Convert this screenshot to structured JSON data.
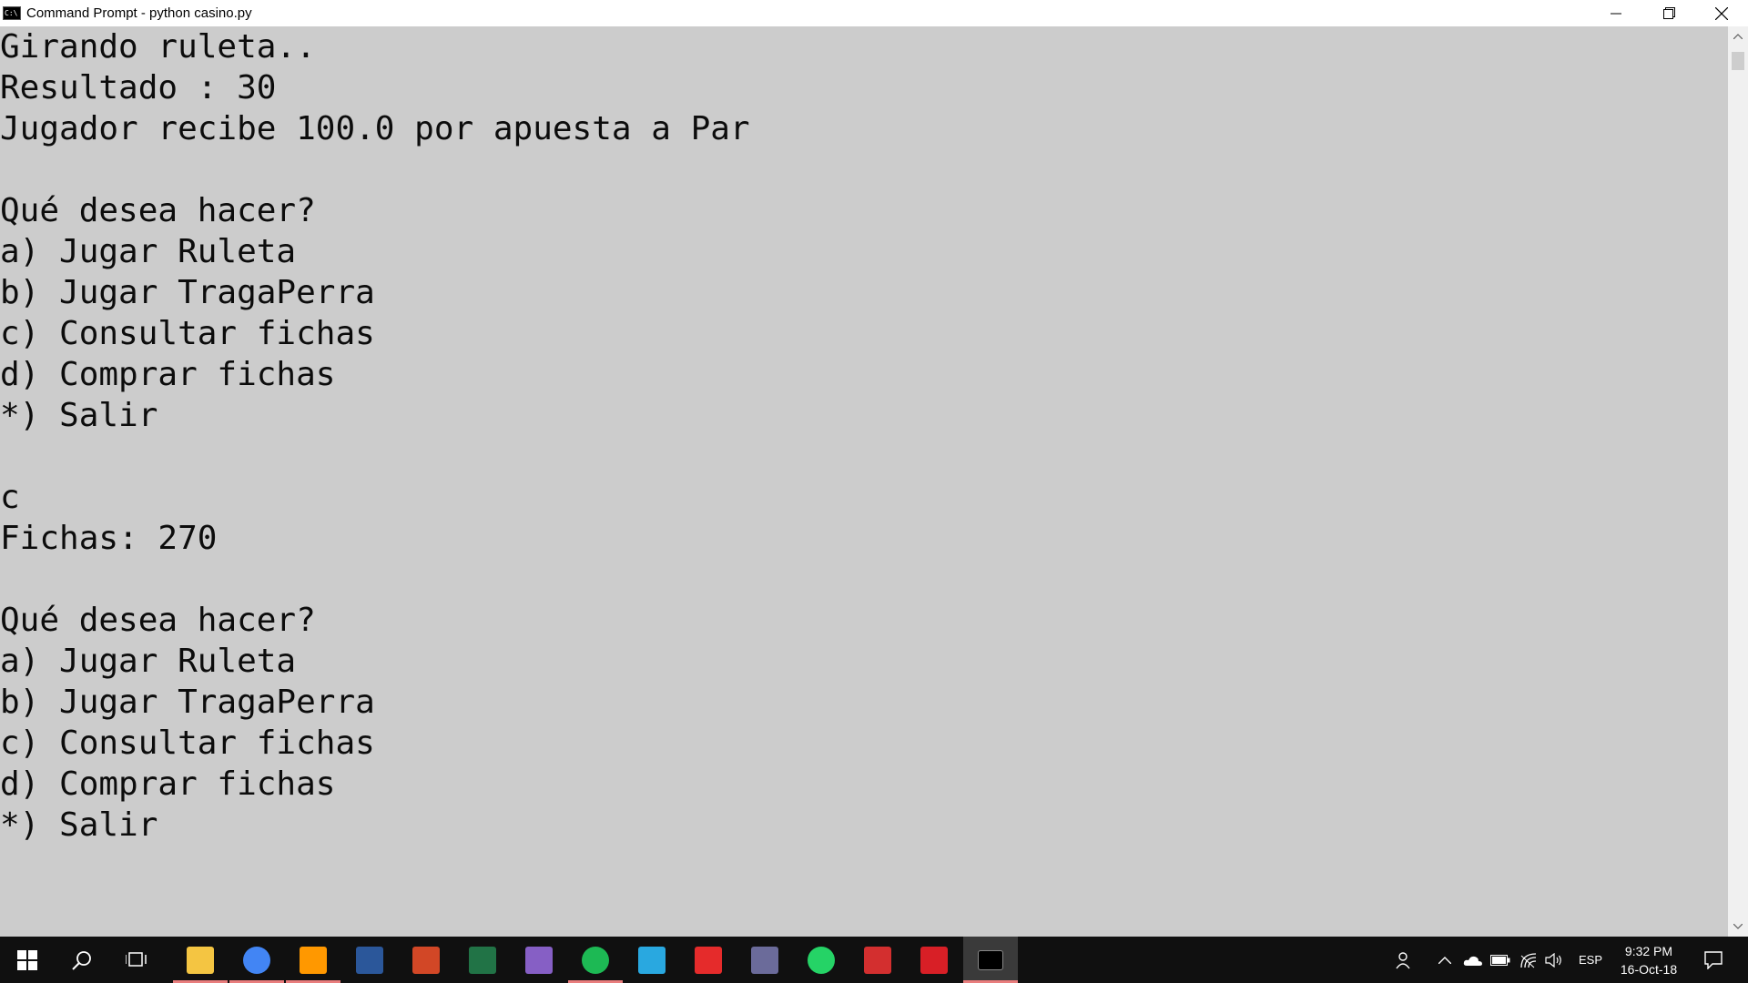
{
  "window": {
    "title": "Command Prompt - python  casino.py"
  },
  "console": {
    "lines": [
      "Girando ruleta..",
      "Resultado : 30",
      "Jugador recibe 100.0 por apuesta a Par",
      "",
      "Qué desea hacer?",
      "a) Jugar Ruleta",
      "b) Jugar TragaPerra",
      "c) Consultar fichas",
      "d) Comprar fichas",
      "*) Salir",
      "",
      "c",
      "Fichas: 270",
      "",
      "Qué desea hacer?",
      "a) Jugar Ruleta",
      "b) Jugar TragaPerra",
      "c) Consultar fichas",
      "d) Comprar fichas",
      "*) Salir",
      ""
    ]
  },
  "taskbar": {
    "apps": [
      {
        "name": "file-explorer",
        "color": "#f4c542"
      },
      {
        "name": "chrome",
        "color": "#4285f4"
      },
      {
        "name": "sublime-text",
        "color": "#ff9800"
      },
      {
        "name": "word",
        "color": "#2b579a"
      },
      {
        "name": "powerpoint",
        "color": "#d24726"
      },
      {
        "name": "excel",
        "color": "#217346"
      },
      {
        "name": "visual-studio",
        "color": "#865fc5"
      },
      {
        "name": "spotify",
        "color": "#1db954"
      },
      {
        "name": "store",
        "color": "#29a8e0"
      },
      {
        "name": "app-red-gear",
        "color": "#e52b2b"
      },
      {
        "name": "app-chart",
        "color": "#6b6b9a"
      },
      {
        "name": "whatsapp",
        "color": "#25d366"
      },
      {
        "name": "arduino",
        "color": "#d32f2f"
      },
      {
        "name": "flash",
        "color": "#d81f26"
      },
      {
        "name": "command-prompt",
        "color": "#000000"
      }
    ],
    "tray": {
      "language": "ESP",
      "time": "9:32 PM",
      "date": "16-Oct-18"
    }
  },
  "colors": {
    "console_bg": "#cccccc",
    "console_fg": "#0c0c0c",
    "taskbar_bg": "#101010"
  }
}
